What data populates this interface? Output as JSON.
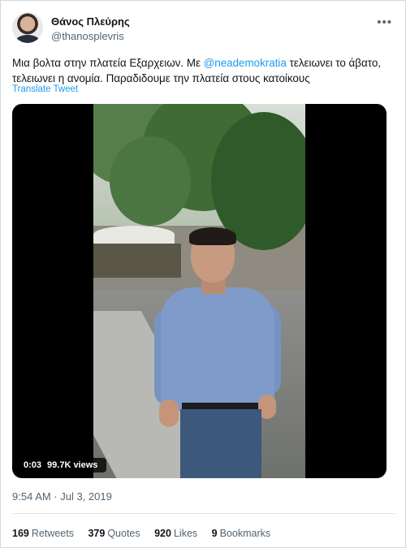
{
  "tweet": {
    "author_name": "Θάνος Πλεύρης",
    "author_handle": "@thanosplevris",
    "more_icon": "more-dots-icon",
    "text_before": "Μια βολτα στην πλατεία Εξαρχειων. Με ",
    "mention": "@neademokratia",
    "text_after": " τελειωνει το άβατο, τελειωνει η ανομία. Παραδιδουμε την πλατεία στους κατοίκους",
    "translate": "Translate Tweet",
    "timestamp": "9:54 AM · Jul 3, 2019"
  },
  "media": {
    "duration": "0:03",
    "views": "99.7K views"
  },
  "stats": [
    {
      "value": "169",
      "label": "Retweets"
    },
    {
      "value": "379",
      "label": "Quotes"
    },
    {
      "value": "920",
      "label": "Likes"
    },
    {
      "value": "9",
      "label": "Bookmarks"
    }
  ],
  "colors": {
    "accent": "#1d9bf0",
    "text": "#0f1419",
    "muted": "#536471"
  }
}
